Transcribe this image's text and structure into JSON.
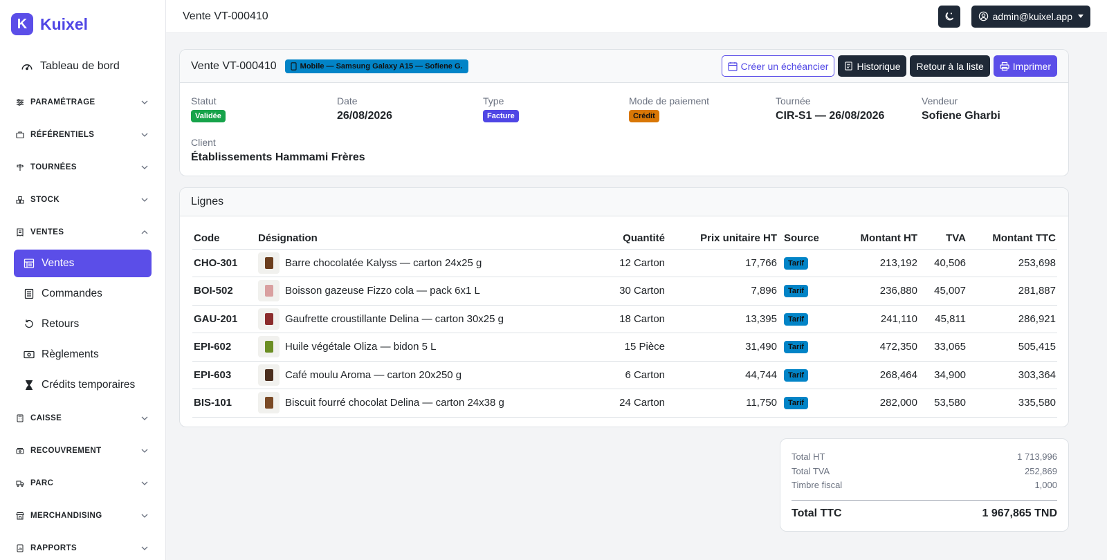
{
  "brand": {
    "name": "Kuixel",
    "logo_letter": "K",
    "accent": "#5b4ee8"
  },
  "sidebar": {
    "dashboard": "Tableau de bord",
    "sections": [
      {
        "id": "parametrage",
        "label": "PARAMÉTRAGE",
        "icon": "sliders-icon"
      },
      {
        "id": "referentiels",
        "label": "RÉFÉRENTIELS",
        "icon": "briefcase-icon"
      },
      {
        "id": "tournees",
        "label": "TOURNÉES",
        "icon": "signpost-icon"
      },
      {
        "id": "stock",
        "label": "STOCK",
        "icon": "boxes-icon"
      },
      {
        "id": "ventes",
        "label": "VENTES",
        "icon": "receipt-icon",
        "expanded": true
      },
      {
        "id": "caisse",
        "label": "CAISSE",
        "icon": "calculator-icon"
      },
      {
        "id": "recouvrement",
        "label": "RECOUVREMENT",
        "icon": "cash-icon"
      },
      {
        "id": "parc",
        "label": "PARC",
        "icon": "truck-icon"
      },
      {
        "id": "merchandising",
        "label": "MERCHANDISING",
        "icon": "shop-icon"
      },
      {
        "id": "rapports",
        "label": "RAPPORTS",
        "icon": "report-icon"
      }
    ],
    "ventes_items": [
      "Ventes",
      "Commandes",
      "Retours",
      "Règlements",
      "Crédits temporaires"
    ]
  },
  "topbar": {
    "title": "Vente VT-000410",
    "user": "admin@kuixel.app"
  },
  "sale": {
    "header_title": "Vente VT-000410",
    "origin_badge": "Mobile — Samsung Galaxy A15 — Sofiene G.",
    "actions": {
      "schedule": "Créer un échéancier",
      "history": "Historique",
      "back": "Retour à la liste",
      "print": "Imprimer"
    },
    "fields": {
      "status_label": "Statut",
      "status_value": "Validée",
      "date_label": "Date",
      "date_value": "26/08/2026",
      "type_label": "Type",
      "type_value": "Facture",
      "payment_label": "Mode de paiement",
      "payment_value": "Crédit",
      "tour_label": "Tournée",
      "tour_value": "CIR-S1 — 26/08/2026",
      "seller_label": "Vendeur",
      "seller_value": "Sofiene Gharbi",
      "client_label": "Client",
      "client_value": "Établissements Hammami Frères"
    }
  },
  "lines": {
    "title": "Lignes",
    "columns": [
      "Code",
      "Désignation",
      "Quantité",
      "Prix unitaire HT",
      "Source",
      "Montant HT",
      "TVA",
      "Montant TTC"
    ],
    "rows": [
      {
        "code": "CHO-301",
        "designation": "Barre chocolatée Kalyss — carton 24x25 g",
        "qty": "12 Carton",
        "unit_price": "17,766",
        "source": "Tarif",
        "amount_ht": "213,192",
        "tva": "40,506",
        "amount_ttc": "253,698",
        "thumb_color": "#6b3e1e"
      },
      {
        "code": "BOI-502",
        "designation": "Boisson gazeuse Fizzo cola — pack 6x1 L",
        "qty": "30 Carton",
        "unit_price": "7,896",
        "source": "Tarif",
        "amount_ht": "236,880",
        "tva": "45,007",
        "amount_ttc": "281,887",
        "thumb_color": "#d9a0a0"
      },
      {
        "code": "GAU-201",
        "designation": "Gaufrette croustillante Delina — carton 30x25 g",
        "qty": "18 Carton",
        "unit_price": "13,395",
        "source": "Tarif",
        "amount_ht": "241,110",
        "tva": "45,811",
        "amount_ttc": "286,921",
        "thumb_color": "#8b2c2c"
      },
      {
        "code": "EPI-602",
        "designation": "Huile végétale Oliza — bidon 5 L",
        "qty": "15 Pièce",
        "unit_price": "31,490",
        "source": "Tarif",
        "amount_ht": "472,350",
        "tva": "33,065",
        "amount_ttc": "505,415",
        "thumb_color": "#6b8e23"
      },
      {
        "code": "EPI-603",
        "designation": "Café moulu Aroma — carton 20x250 g",
        "qty": "6 Carton",
        "unit_price": "44,744",
        "source": "Tarif",
        "amount_ht": "268,464",
        "tva": "34,900",
        "amount_ttc": "303,364",
        "thumb_color": "#4a2e1e"
      },
      {
        "code": "BIS-101",
        "designation": "Biscuit fourré chocolat Delina — carton 24x38 g",
        "qty": "24 Carton",
        "unit_price": "11,750",
        "source": "Tarif",
        "amount_ht": "282,000",
        "tva": "53,580",
        "amount_ttc": "335,580",
        "thumb_color": "#7a4a26"
      }
    ]
  },
  "totals": {
    "ht_label": "Total HT",
    "ht_value": "1 713,996",
    "tva_label": "Total TVA",
    "tva_value": "252,869",
    "stamp_label": "Timbre fiscal",
    "stamp_value": "1,000",
    "ttc_label": "Total TTC",
    "ttc_value": "1 967,865 TND"
  },
  "colors": {
    "success": "#16a34a",
    "info": "#0284c7",
    "warning": "#d97706",
    "dark": "#1f2937"
  }
}
